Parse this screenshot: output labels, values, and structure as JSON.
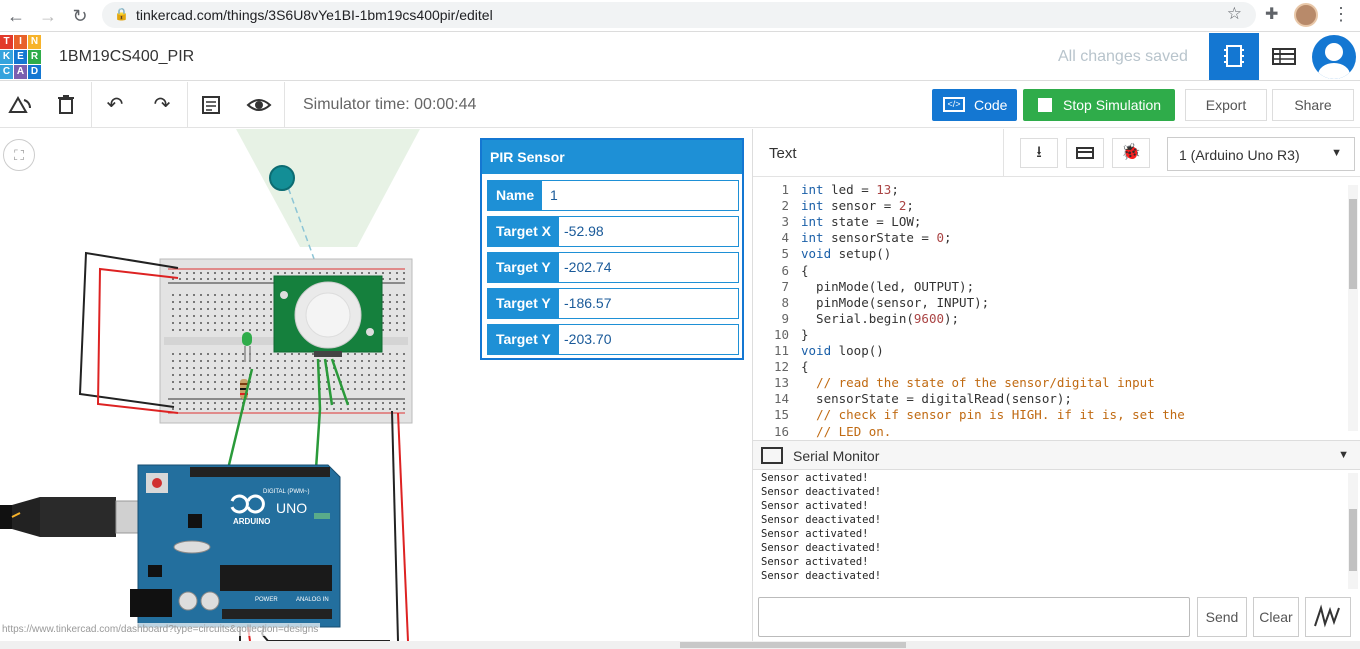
{
  "browser": {
    "url": "tinkercad.com/things/3S6U8vYe1BI-1bm19cs400pir/editel"
  },
  "app": {
    "logo_letters": [
      "T",
      "I",
      "N",
      "K",
      "E",
      "R",
      "C",
      "A",
      "D"
    ],
    "logo_colors": [
      "#e23a2b",
      "#e8622a",
      "#f7b32b",
      "#35a3dd",
      "#1477d2",
      "#2fac4a",
      "#35a3dd",
      "#7a5fb0",
      "#1477d2"
    ],
    "project_title": "1BM19CS400_PIR",
    "save_status": "All changes saved"
  },
  "toolbar": {
    "sim_time": "Simulator time: 00:00:44",
    "code_label": "Code",
    "code_icon": "</>",
    "stop_label": "Stop Simulation",
    "export_label": "Export",
    "share_label": "Share"
  },
  "pir_panel": {
    "title": "PIR Sensor",
    "rows": [
      {
        "key": "Name",
        "value": "1"
      },
      {
        "key": "Target X",
        "value": "-52.98"
      },
      {
        "key": "Target Y",
        "value": "-202.74"
      },
      {
        "key": "Target Y",
        "value": "-186.57"
      },
      {
        "key": "Target Y",
        "value": "-203.70"
      }
    ]
  },
  "code": {
    "mode": "Text",
    "device": "1 (Arduino Uno R3)",
    "lines": [
      "int led = 13;",
      "int sensor = 2;",
      "int state = LOW;",
      "int sensorState = 0;",
      "void setup()",
      "{",
      "  pinMode(led, OUTPUT);",
      "  pinMode(sensor, INPUT);",
      "  Serial.begin(9600);",
      "}",
      "void loop()",
      "{",
      "  // read the state of the sensor/digital input",
      "  sensorState = digitalRead(sensor);",
      "  // check if sensor pin is HIGH. if it is, set the",
      "  // LED on."
    ]
  },
  "serial": {
    "title": "Serial Monitor",
    "output": [
      "Sensor activated!",
      "Sensor deactivated!",
      "Sensor activated!",
      "Sensor deactivated!",
      "Sensor activated!",
      "Sensor deactivated!",
      "Sensor activated!",
      "Sensor deactivated!"
    ],
    "send_label": "Send",
    "clear_label": "Clear"
  },
  "status_url": "https://www.tinkercad.com/dashboard?type=circuits&collection=designs",
  "arduino": {
    "brand": "ARDUINO",
    "model": "UNO",
    "digital_label": "DIGITAL (PWM~)",
    "power_label": "POWER",
    "analog_label": "ANALOG IN"
  }
}
